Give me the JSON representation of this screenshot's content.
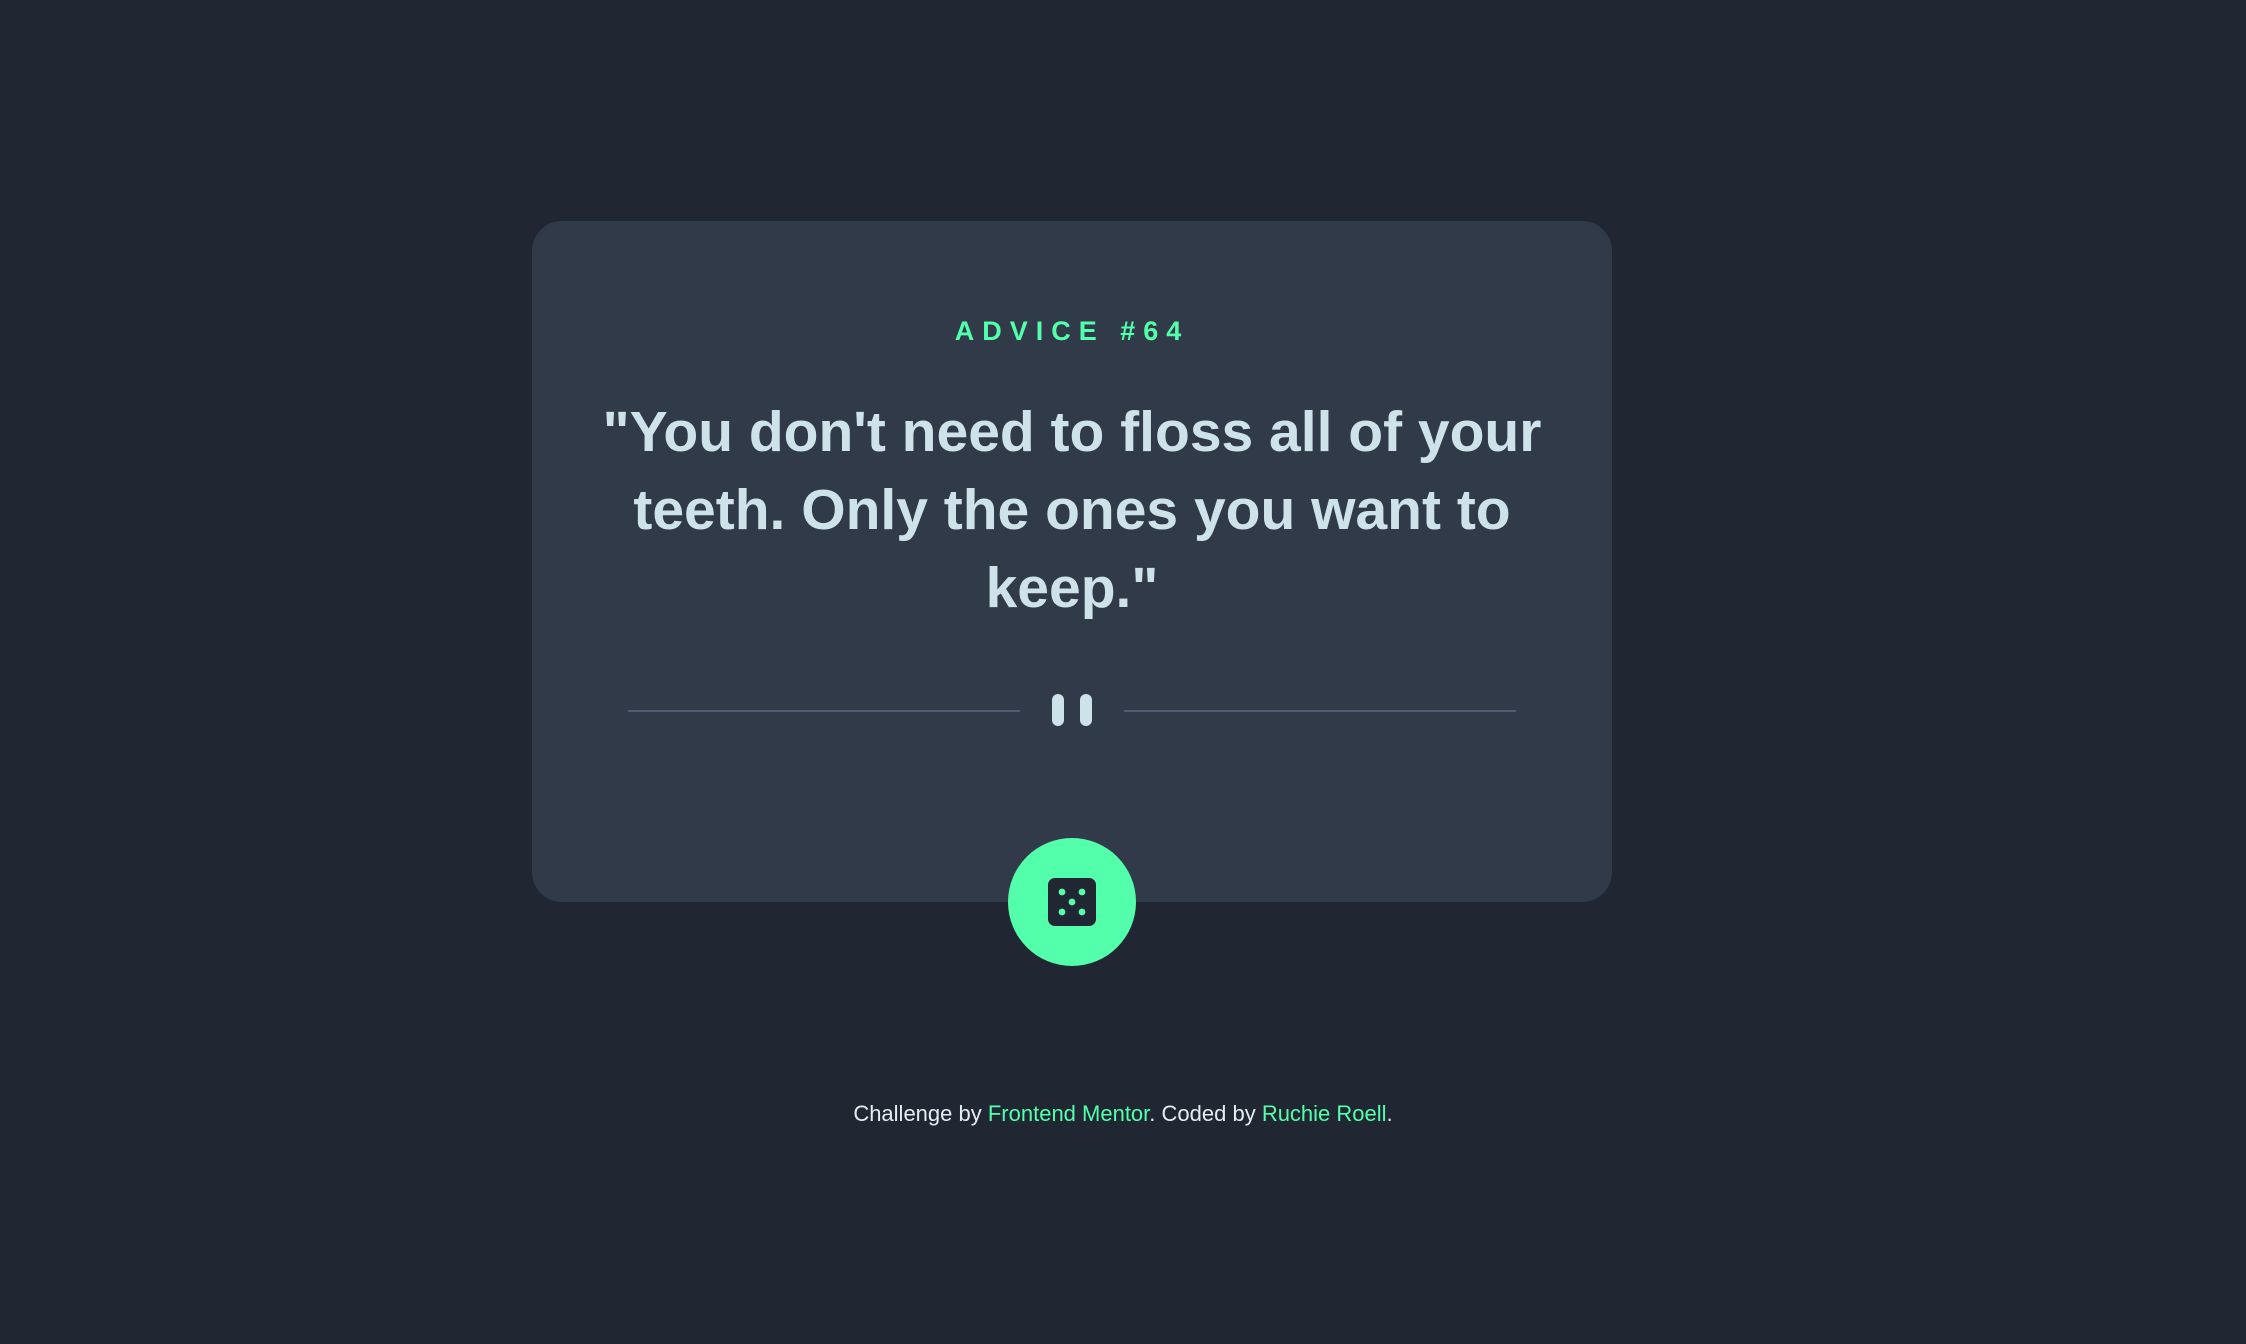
{
  "advice": {
    "id_label": "ADVICE #64",
    "text": "\"You don't need to floss all of your teeth. Only the ones you want to keep.\""
  },
  "divider": {
    "icon": "pause-icon"
  },
  "dice_button": {
    "icon": "dice-icon",
    "aria_label": "Get new advice"
  },
  "footer": {
    "prefix": "Challenge by ",
    "challenge_link": "Frontend Mentor",
    "middle": ". Coded by ",
    "author_link": "Ruchie Roell",
    "suffix": "."
  },
  "colors": {
    "background": "#202632",
    "card": "#313a48",
    "accent": "#53ffaa",
    "text": "#cee3e9",
    "divider": "#4f5d74"
  }
}
